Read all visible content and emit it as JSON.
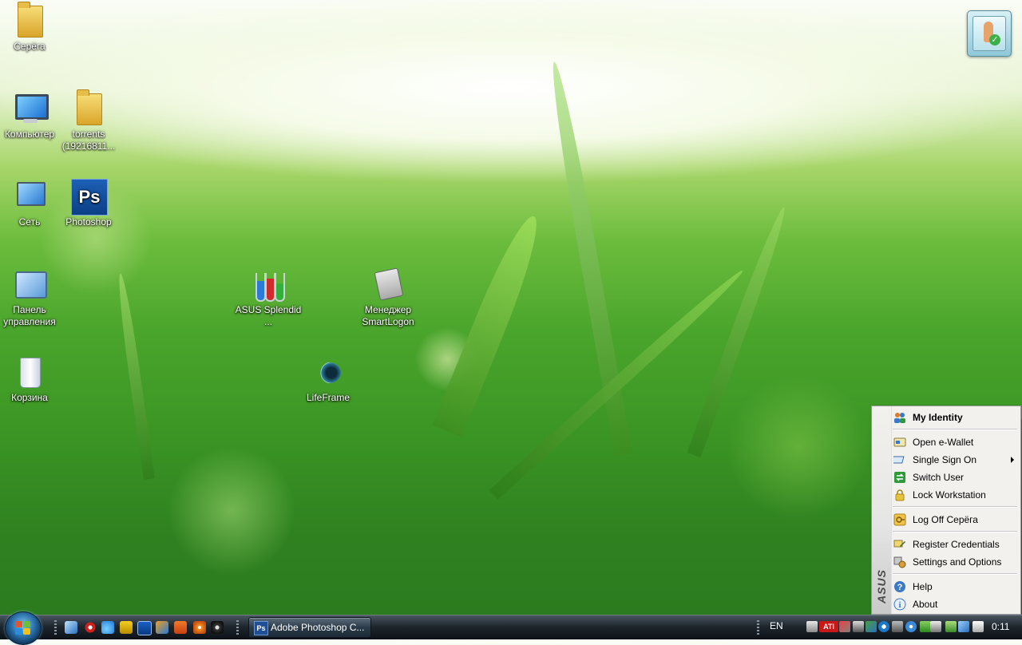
{
  "desktop": {
    "icons": [
      {
        "label": "Серёга"
      },
      {
        "label": "Компьютер"
      },
      {
        "label": "torrents (19216811..."
      },
      {
        "label": "Сеть"
      },
      {
        "label": "Photoshop"
      },
      {
        "label": "Панель управления"
      },
      {
        "label": "ASUS Splendid ..."
      },
      {
        "label": "Менеджер SmartLogon"
      },
      {
        "label": "Корзина"
      },
      {
        "label": "LifeFrame"
      }
    ],
    "photoshop_badge": "Ps"
  },
  "context_menu": {
    "brand": "ASUS",
    "items": [
      {
        "label": "My Identity",
        "icon": "identity-icon"
      },
      {
        "label": "Open e-Wallet",
        "icon": "wallet-icon"
      },
      {
        "label": "Single Sign On",
        "icon": "sso-icon"
      },
      {
        "label": "Switch User",
        "icon": "switch-user-icon"
      },
      {
        "label": "Lock Workstation",
        "icon": "lock-icon"
      },
      {
        "label": "Log Off Серёга",
        "icon": "logoff-icon"
      },
      {
        "label": "Register Credentials",
        "icon": "register-icon"
      },
      {
        "label": "Settings and Options",
        "icon": "settings-icon"
      },
      {
        "label": "Help",
        "icon": "help-icon"
      },
      {
        "label": "About",
        "icon": "about-icon"
      }
    ]
  },
  "taskbar": {
    "task_button": {
      "label": "Adobe Photoshop C...",
      "icon_text": "Ps"
    },
    "language": "EN",
    "clock": "0:11",
    "tray_badge": "ATI"
  },
  "colors": {
    "taskbar_dark": "#0c1116",
    "menu_bg": "#f2f1ed",
    "grass_green": "#3b9524"
  }
}
